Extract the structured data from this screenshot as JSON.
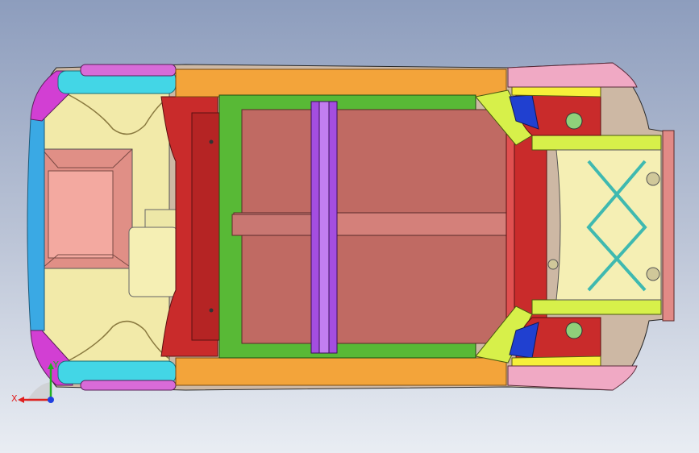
{
  "viewport": {
    "background_top": "#8d9dbd",
    "background_bottom": "#e9edf3"
  },
  "model_colors": {
    "floor": "#c06a63",
    "rail_orange": "#f3a43a",
    "frame_green": "#58b936",
    "crossmember_purple": "#a44ee0",
    "seat_cream": "#f2eaa9",
    "wheel_cyan": "#43d6e6",
    "bumper_blue": "#3aa9e4",
    "corner_magenta": "#d23fd3",
    "firewall_red": "#c92b2b",
    "suspension_lime": "#d7f04a",
    "front_pink": "#f0a9c4"
  },
  "triad": {
    "x_label": "X",
    "y_label": "Y",
    "x_color": "#e02020",
    "y_color": "#20b020",
    "z_color": "#2040e0"
  }
}
